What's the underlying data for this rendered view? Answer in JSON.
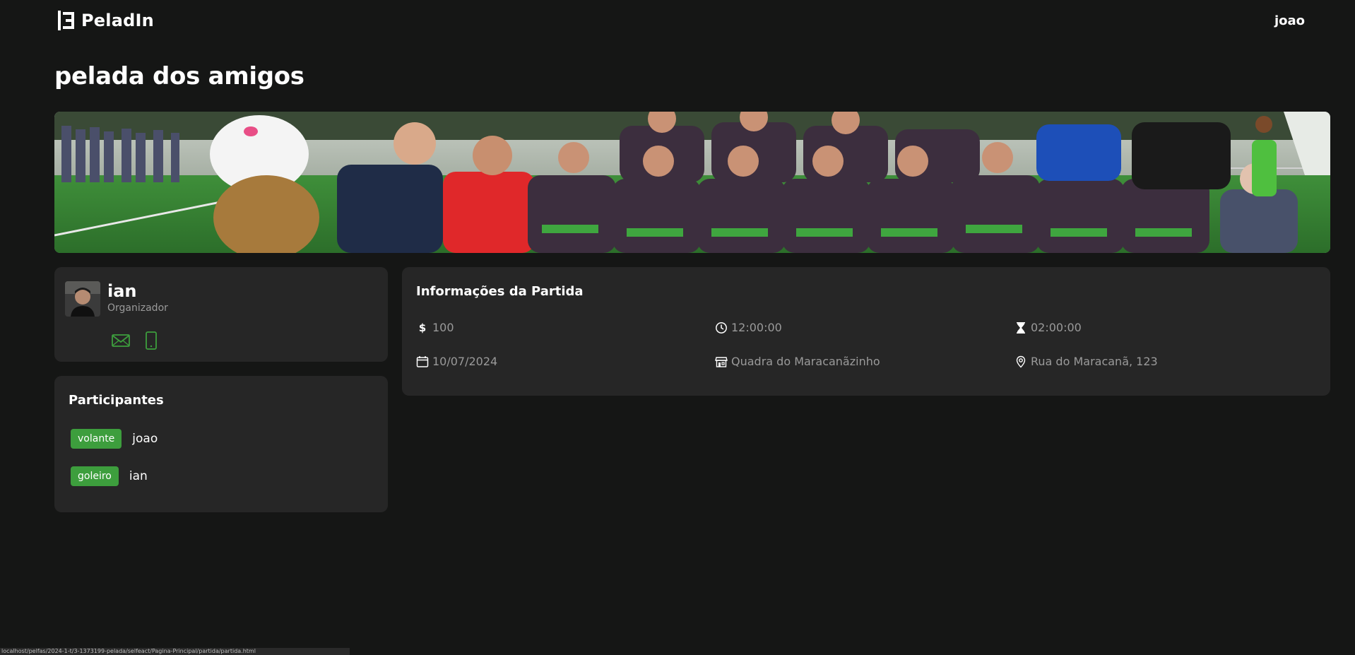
{
  "navbar": {
    "brand": "PeladIn",
    "user": "joao"
  },
  "match": {
    "title": "pelada dos amigos"
  },
  "organizer": {
    "name": "ian",
    "role": "Organizador",
    "contacts": [
      "mail-icon",
      "phone-icon"
    ]
  },
  "participants": {
    "title": "Participantes",
    "items": [
      {
        "position": "volante",
        "name": "joao"
      },
      {
        "position": "goleiro",
        "name": "ian"
      }
    ]
  },
  "info": {
    "title": "Informações da Partida",
    "price": "100",
    "time": "12:00:00",
    "duration": "02:00:00",
    "date": "10/07/2024",
    "venue": "Quadra do Maracanãzinho",
    "address": "Rua do Maracanã, 123"
  },
  "status_bar": {
    "text": "localhost/pelfas/2024-1-t/3-1373199-pelada/selfeact/Pagina-Principal/partida/partida.html"
  },
  "colors": {
    "background": "#151615",
    "card": "#262626",
    "badge": "#3d9e3d",
    "contact_icon": "#3d9e3d",
    "muted_text": "#9a9a9a"
  }
}
